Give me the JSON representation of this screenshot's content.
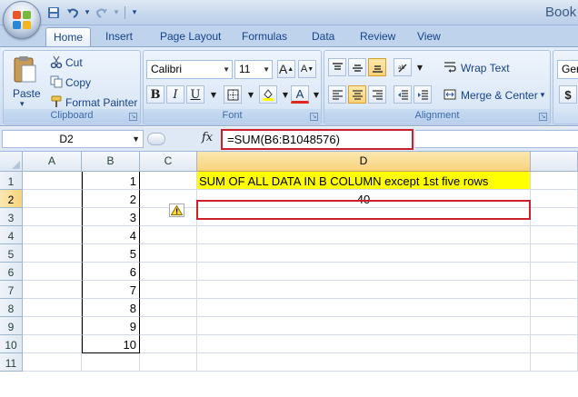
{
  "window": {
    "title": "Book"
  },
  "quick_access": [
    {
      "name": "save-icon",
      "glyph": "💾"
    },
    {
      "name": "undo-icon",
      "glyph": "↶"
    },
    {
      "name": "undo-dropdown-icon",
      "glyph": "▾"
    },
    {
      "name": "redo-icon",
      "glyph": "↷"
    },
    {
      "name": "redo-dropdown-icon",
      "glyph": "▾"
    },
    {
      "name": "customize-toolbar-icon",
      "glyph": "▾"
    }
  ],
  "tabs": [
    "Home",
    "Insert",
    "Page Layout",
    "Formulas",
    "Data",
    "Review",
    "View"
  ],
  "active_tab": "Home",
  "ribbon": {
    "clipboard": {
      "label": "Clipboard",
      "paste": "Paste",
      "cut": "Cut",
      "copy": "Copy",
      "format_painter": "Format Painter"
    },
    "font": {
      "label": "Font",
      "font_name": "Calibri",
      "font_size": "11",
      "bold": "B",
      "italic": "I",
      "underline": "U",
      "font_color": "A"
    },
    "alignment": {
      "label": "Alignment",
      "wrap_text": "Wrap Text",
      "merge_center": "Merge & Center"
    },
    "number": {
      "format": "Gen",
      "currency": "$"
    }
  },
  "formula_bar": {
    "name_box": "D2",
    "fx": "fx",
    "formula": "=SUM(B6:B1048576)"
  },
  "columns": [
    "A",
    "B",
    "C",
    "D"
  ],
  "rows": [
    "1",
    "2",
    "3",
    "4",
    "5",
    "6",
    "7",
    "8",
    "9",
    "10",
    "11"
  ],
  "cells": {
    "B": [
      "1",
      "2",
      "3",
      "4",
      "5",
      "6",
      "7",
      "8",
      "9",
      "10"
    ],
    "D1": "SUM OF ALL DATA IN B COLUMN except 1st five rows",
    "D2": "40"
  },
  "colors": {
    "highlight": "#ffff00",
    "annotation_border": "#cc1f2c",
    "selected_header": "#f8d37c"
  }
}
